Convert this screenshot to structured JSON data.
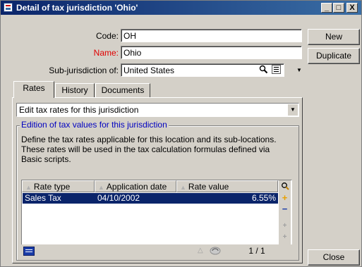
{
  "window": {
    "title": "Detail of tax jurisdiction 'Ohio'",
    "controls": {
      "minimize": "_",
      "maximize": "□",
      "close": "X"
    }
  },
  "form": {
    "code_label": "Code:",
    "code_value": "OH",
    "name_label": "Name:",
    "name_value": "Ohio",
    "subjurisdiction_label": "Sub-jurisdiction of:",
    "subjurisdiction_value": "United States"
  },
  "buttons": {
    "new": "New",
    "duplicate": "Duplicate",
    "close": "Close"
  },
  "tabs": [
    {
      "label": "Rates",
      "active": true
    },
    {
      "label": "History",
      "active": false
    },
    {
      "label": "Documents",
      "active": false
    }
  ],
  "rates": {
    "mode_value": "Edit tax rates for this jurisdiction",
    "group_title": "Edition of tax values for this jurisdiction",
    "description": "Define the tax rates applicable for this location and its sub-locations.\nThese rates will be used in the tax calculation formulas defined via\nBasic scripts.",
    "columns": [
      "Rate type",
      "Application date",
      "Rate value"
    ],
    "rows": [
      {
        "rate_type": "Sales Tax",
        "application_date": "04/10/2002",
        "rate_value": "6.55%"
      }
    ],
    "counter": "1 / 1"
  },
  "icons": {
    "search": "magnifier-icon",
    "detail": "detail-icon",
    "add": "+",
    "remove": "−"
  },
  "colors": {
    "title_bar": "#0a246a",
    "selection": "#0a246a",
    "required_label": "#e00000",
    "legend": "#0000c0"
  }
}
